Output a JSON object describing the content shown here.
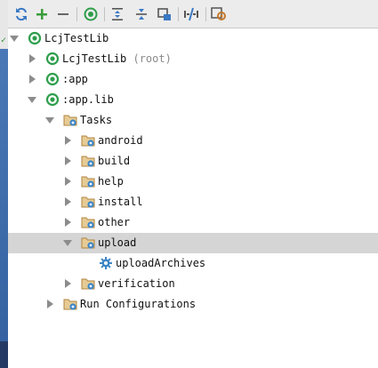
{
  "toolbar": {
    "buttons": [
      {
        "icon": "refresh-icon"
      },
      {
        "icon": "plus-icon"
      },
      {
        "icon": "minus-icon"
      },
      {
        "icon": "execute-task-icon"
      },
      {
        "icon": "expand-all-icon"
      },
      {
        "icon": "collapse-all-icon"
      },
      {
        "icon": "attach-icon"
      },
      {
        "icon": "toggle-offline-icon"
      },
      {
        "icon": "settings-icon"
      }
    ]
  },
  "tree": {
    "nodes": [
      {
        "label": "LcjTestLib",
        "suffix": "",
        "icon": "gradle-project-icon",
        "state": "expanded"
      },
      {
        "label": "LcjTestLib",
        "suffix": "(root)",
        "icon": "gradle-project-icon",
        "state": "collapsed"
      },
      {
        "label": ":app",
        "suffix": "",
        "icon": "gradle-project-icon",
        "state": "collapsed"
      },
      {
        "label": ":app.lib",
        "suffix": "",
        "icon": "gradle-project-icon",
        "state": "expanded"
      },
      {
        "label": "Tasks",
        "suffix": "",
        "icon": "folder-gear-icon",
        "state": "expanded"
      },
      {
        "label": "android",
        "suffix": "",
        "icon": "folder-gear-icon",
        "state": "collapsed"
      },
      {
        "label": "build",
        "suffix": "",
        "icon": "folder-gear-icon",
        "state": "collapsed"
      },
      {
        "label": "help",
        "suffix": "",
        "icon": "folder-gear-icon",
        "state": "collapsed"
      },
      {
        "label": "install",
        "suffix": "",
        "icon": "folder-gear-icon",
        "state": "collapsed"
      },
      {
        "label": "other",
        "suffix": "",
        "icon": "folder-gear-icon",
        "state": "collapsed"
      },
      {
        "label": "upload",
        "suffix": "",
        "icon": "folder-gear-icon",
        "state": "expanded"
      },
      {
        "label": "uploadArchives",
        "suffix": "",
        "icon": "gear-icon",
        "state": "leaf"
      },
      {
        "label": "verification",
        "suffix": "",
        "icon": "folder-gear-icon",
        "state": "collapsed"
      },
      {
        "label": "Run Configurations",
        "suffix": "",
        "icon": "folder-gear-icon",
        "state": "collapsed"
      }
    ],
    "selected": "upload"
  },
  "colors": {
    "accent_green": "#3a9c3a",
    "gradle_green": "#2e9e4b",
    "folder": "#c8a26a",
    "gear_blue": "#3d86c6",
    "selection": "#d5d5d5"
  }
}
